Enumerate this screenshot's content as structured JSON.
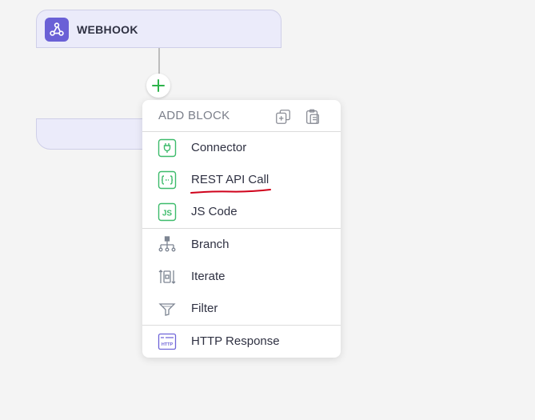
{
  "trigger": {
    "title": "WEBHOOK",
    "icon": "webhook-icon",
    "icon_color": "#6a60d6"
  },
  "add_button": {
    "icon": "plus-icon",
    "color": "#2db34a"
  },
  "menu": {
    "header": {
      "title": "ADD BLOCK",
      "icons": [
        "copy-icon",
        "paste-icon"
      ]
    },
    "sections": [
      [
        {
          "label": "Connector",
          "icon": "plug-icon"
        },
        {
          "label": "REST API Call",
          "icon": "api-braces-icon"
        },
        {
          "label": "JS Code",
          "icon": "js-icon"
        }
      ],
      [
        {
          "label": "Branch",
          "icon": "branch-icon"
        },
        {
          "label": "Iterate",
          "icon": "iterate-icon"
        },
        {
          "label": "Filter",
          "icon": "filter-icon"
        }
      ],
      [
        {
          "label": "HTTP Response",
          "icon": "http-response-icon"
        }
      ]
    ]
  },
  "annotation": {
    "underline_color": "#d0021b"
  }
}
